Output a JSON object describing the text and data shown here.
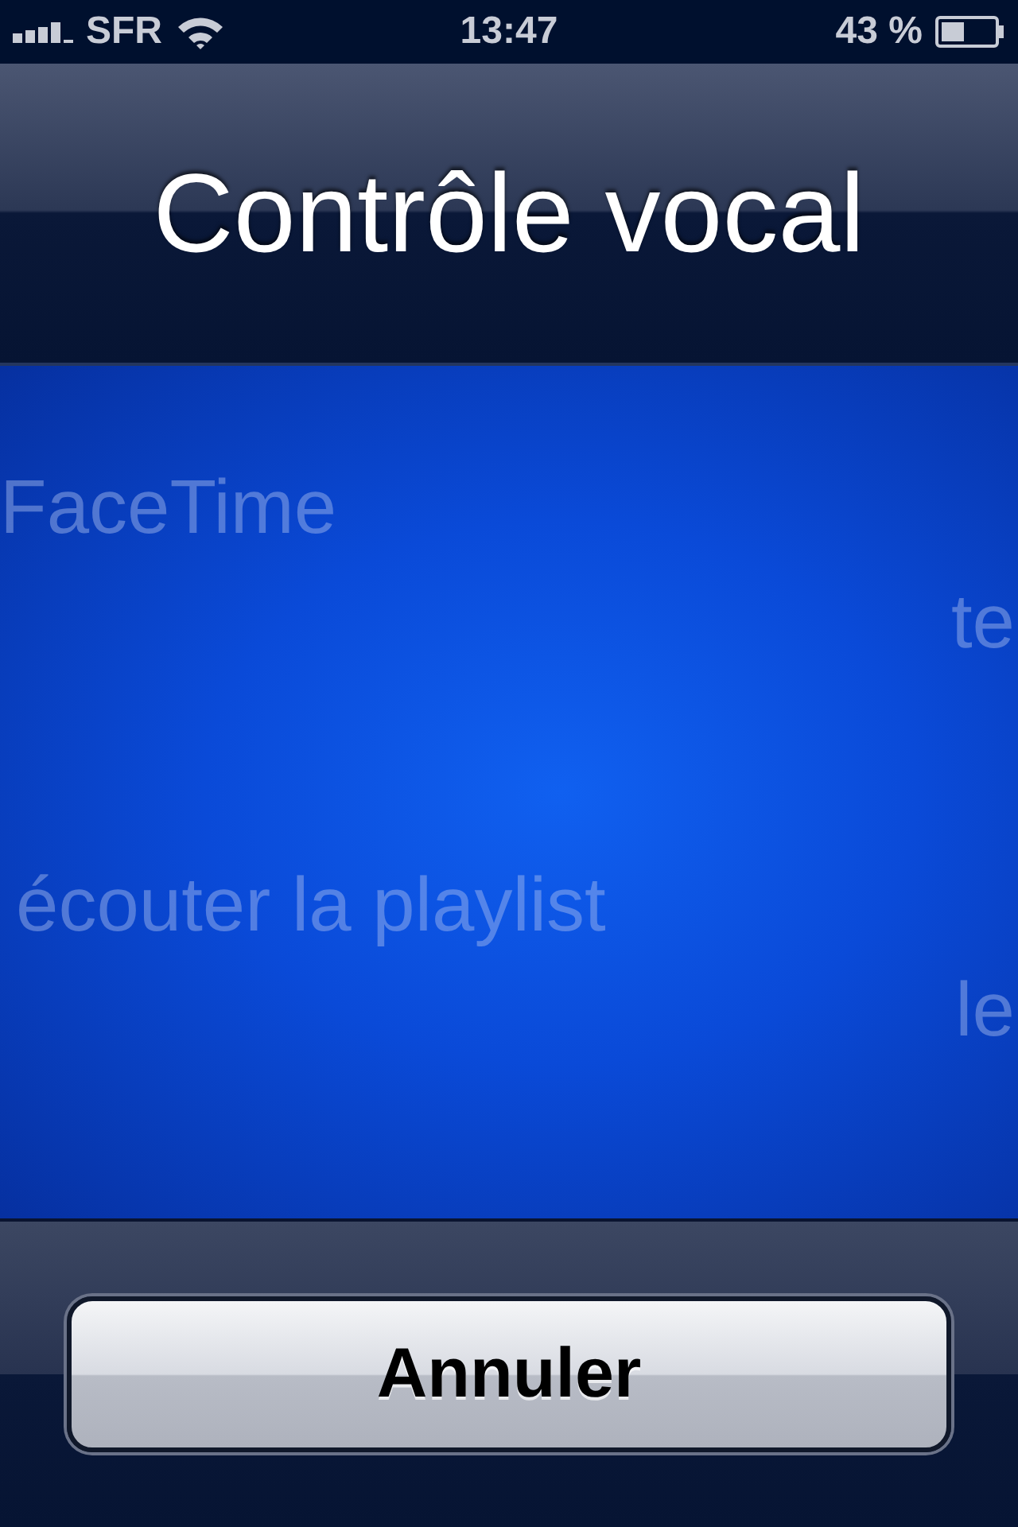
{
  "status_bar": {
    "carrier": "SFR",
    "time": "13:47",
    "battery": "43 %"
  },
  "title": "Contrôle vocal",
  "phrases": [
    {
      "text": "FaceTime"
    },
    {
      "text": "te"
    },
    {
      "text": "écouter la playlist"
    },
    {
      "text": "le"
    }
  ],
  "cancel_button": {
    "label": "Annuler"
  }
}
